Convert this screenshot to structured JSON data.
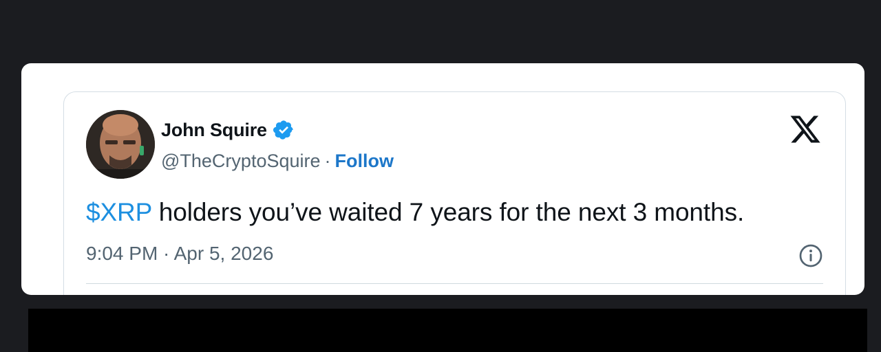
{
  "tweet": {
    "author_name": "John Squire",
    "author_handle": "@TheCryptoSquire",
    "separator": "·",
    "follow_label": "Follow",
    "cashtag": "$XRP",
    "body_text": " holders you’ve waited 7 years for the next 3 months.",
    "time": "9:04 PM · Apr 5, 2026"
  },
  "icons": {
    "verified": "verified-badge-icon",
    "platform": "x-logo-icon",
    "info": "info-icon"
  },
  "colors": {
    "page_background": "#1b1c20",
    "card_background": "#ffffff",
    "verified_blue": "#1d9bf0",
    "link_blue": "#1d77c9",
    "muted_text": "#536471"
  }
}
